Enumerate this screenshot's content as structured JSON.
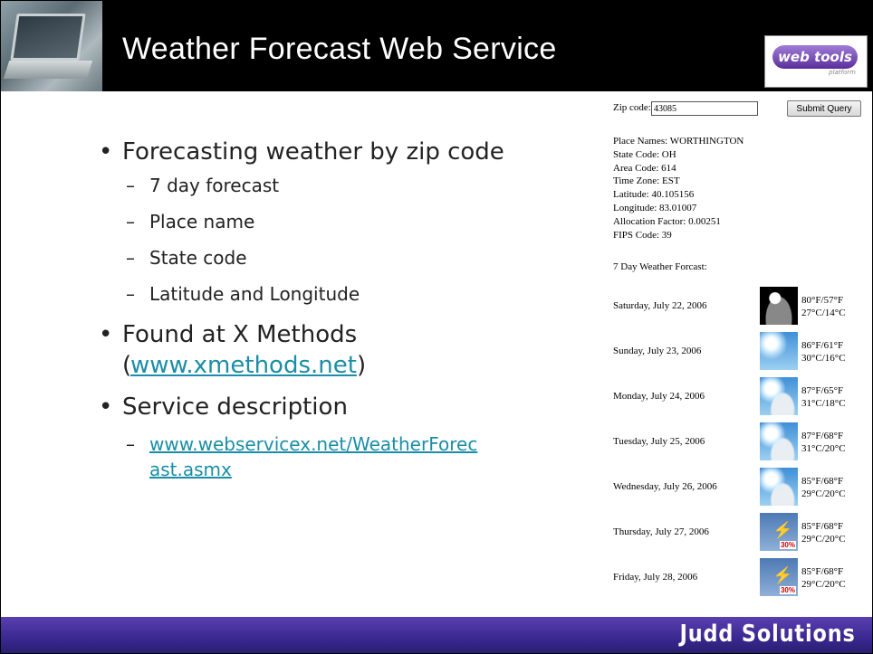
{
  "slide": {
    "title": "Weather Forecast Web Service",
    "logo_text": "web tools",
    "logo_sub": "platform",
    "footer_brand": "Judd Solutions"
  },
  "bullets": {
    "item1": "Forecasting weather by zip code",
    "item1_subs": [
      "7 day forecast",
      "Place name",
      "State code",
      "Latitude and Longitude"
    ],
    "item2_prefix": "Found at X Methods",
    "item2_open": "(",
    "item2_link": "www.xmethods.net",
    "item2_close": ")",
    "item3": "Service description",
    "item3_link_line1": "www.webservicex.net/WeatherForec",
    "item3_link_line2": "ast.asmx"
  },
  "web": {
    "zip_label": "Zip code:",
    "zip_value": "43085",
    "submit_label": "Submit Query",
    "info": [
      "Place Names: WORTHINGTON",
      "State Code: OH",
      "Area Code: 614",
      "Time Zone: EST",
      "Latitude: 40.105156",
      "Longitude: 83.01007",
      "Allocation Factor: 0.00251",
      "FIPS Code: 39"
    ],
    "forecast_title": "7 Day Weather Forcast:",
    "days": [
      {
        "date": "Saturday, July 22, 2006",
        "f": "80°F/57°F",
        "c": "27°C/14°C",
        "icon": "night-clear-icon"
      },
      {
        "date": "Sunday, July 23, 2006",
        "f": "86°F/61°F",
        "c": "30°C/16°C",
        "icon": "sunny-icon"
      },
      {
        "date": "Monday, July 24, 2006",
        "f": "87°F/65°F",
        "c": "31°C/18°C",
        "icon": "partly-cloudy-icon"
      },
      {
        "date": "Tuesday, July 25, 2006",
        "f": "87°F/68°F",
        "c": "31°C/20°C",
        "icon": "partly-cloudy-icon"
      },
      {
        "date": "Wednesday, July 26, 2006",
        "f": "85°F/68°F",
        "c": "29°C/20°C",
        "icon": "partly-cloudy-icon"
      },
      {
        "date": "Thursday, July 27, 2006",
        "f": "85°F/68°F",
        "c": "29°C/20°C",
        "icon": "thunderstorm-icon",
        "pct": "30%"
      },
      {
        "date": "Friday, July 28, 2006",
        "f": "85°F/68°F",
        "c": "29°C/20°C",
        "icon": "thunderstorm-icon",
        "pct": "30%"
      }
    ]
  }
}
